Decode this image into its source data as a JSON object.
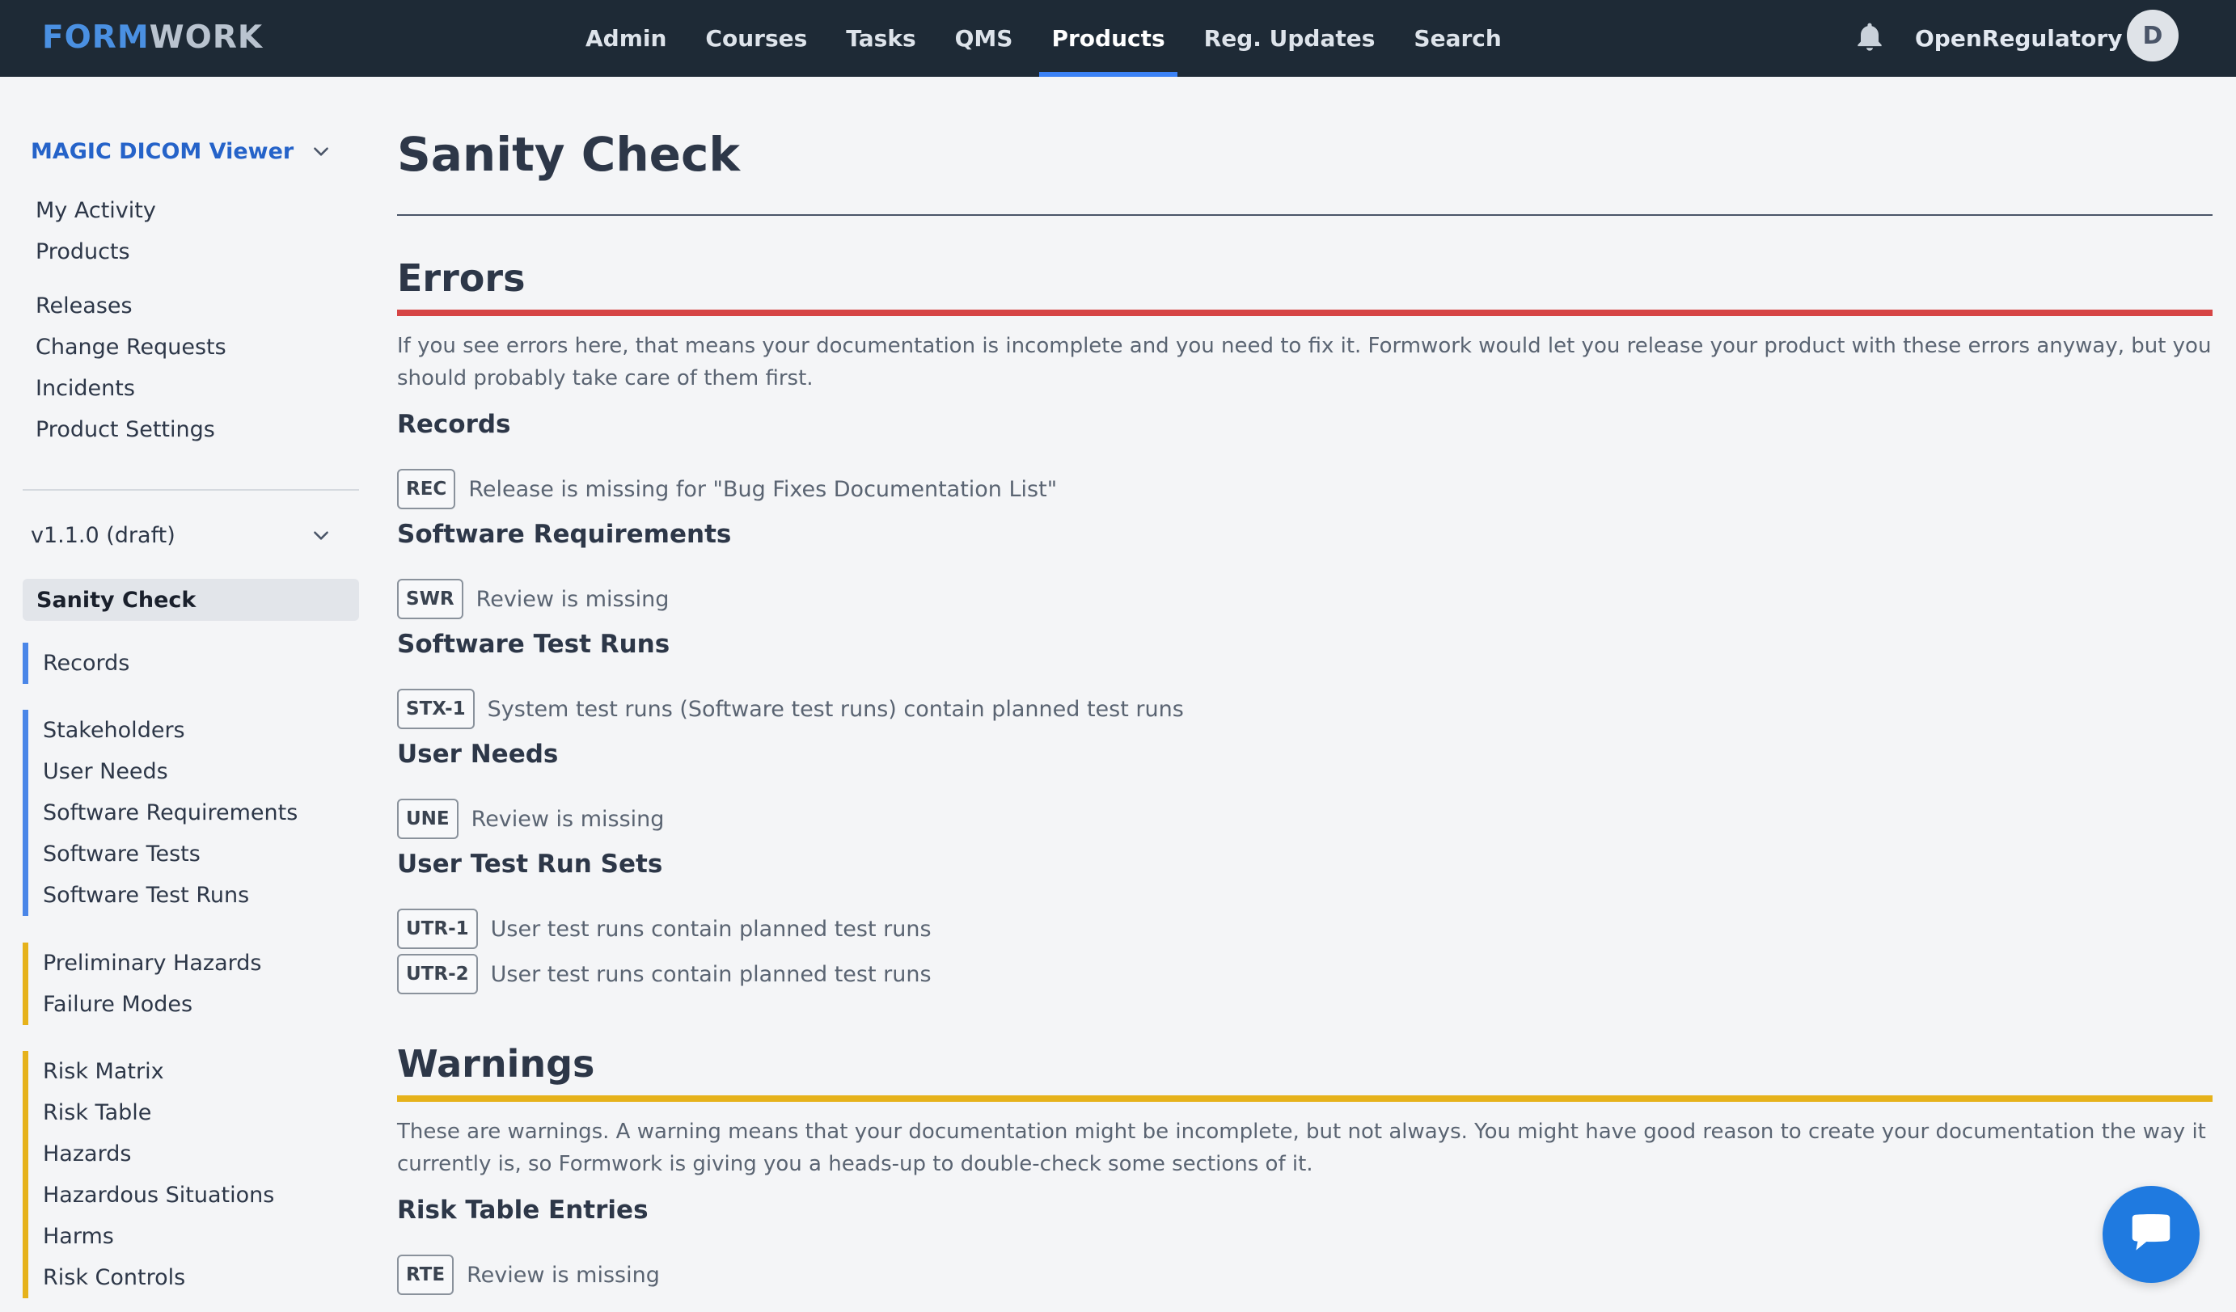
{
  "header": {
    "logo_part1": "FORM",
    "logo_part2": "WORK",
    "nav": [
      "Admin",
      "Courses",
      "Tasks",
      "QMS",
      "Products",
      "Reg. Updates",
      "Search"
    ],
    "active_nav": "Products",
    "org_name": "OpenRegulatory",
    "avatar_initial": "D"
  },
  "sidebar": {
    "product_name": "MAGIC DICOM Viewer",
    "links_top": [
      "My Activity",
      "Products"
    ],
    "links_mid": [
      "Releases",
      "Change Requests",
      "Incidents",
      "Product Settings"
    ],
    "version": "v1.1.0 (draft)",
    "active_item": "Sanity Check",
    "group_records": [
      "Records"
    ],
    "group_software": [
      "Stakeholders",
      "User Needs",
      "Software Requirements",
      "Software Tests",
      "Software Test Runs"
    ],
    "group_hazards": [
      "Preliminary Hazards",
      "Failure Modes"
    ],
    "group_risk": [
      "Risk Matrix",
      "Risk Table",
      "Hazards",
      "Hazardous Situations",
      "Harms",
      "Risk Controls"
    ]
  },
  "main": {
    "title": "Sanity Check",
    "errors": {
      "title": "Errors",
      "description": "If you see errors here, that means your documentation is incomplete and you need to fix it. Formwork would let you release your product with these errors anyway, but you should probably take care of them first.",
      "categories": [
        {
          "name": "Records",
          "issues": [
            {
              "code": "REC",
              "message": "Release is missing for \"Bug Fixes Documentation List\""
            }
          ]
        },
        {
          "name": "Software Requirements",
          "issues": [
            {
              "code": "SWR",
              "message": "Review is missing"
            }
          ]
        },
        {
          "name": "Software Test Runs",
          "issues": [
            {
              "code": "STX-1",
              "message": "System test runs (Software test runs) contain planned test runs"
            }
          ]
        },
        {
          "name": "User Needs",
          "issues": [
            {
              "code": "UNE",
              "message": "Review is missing"
            }
          ]
        },
        {
          "name": "User Test Run Sets",
          "issues": [
            {
              "code": "UTR-1",
              "message": "User test runs contain planned test runs"
            },
            {
              "code": "UTR-2",
              "message": "User test runs contain planned test runs"
            }
          ]
        }
      ]
    },
    "warnings": {
      "title": "Warnings",
      "description": "These are warnings. A warning means that your documentation might be incomplete, but not always. You might have good reason to create your documentation the way it currently is, so Formwork is giving you a heads-up to double-check some sections of it.",
      "categories": [
        {
          "name": "Risk Table Entries",
          "issues": [
            {
              "code": "RTE",
              "message": "Review is missing"
            }
          ]
        }
      ]
    }
  },
  "colors": {
    "topbar": "#1e2a36",
    "accent_blue": "#3b82f6",
    "error_red": "#d64545",
    "warning_yellow": "#e6b21b",
    "chat_blue": "#1f7ae0"
  }
}
